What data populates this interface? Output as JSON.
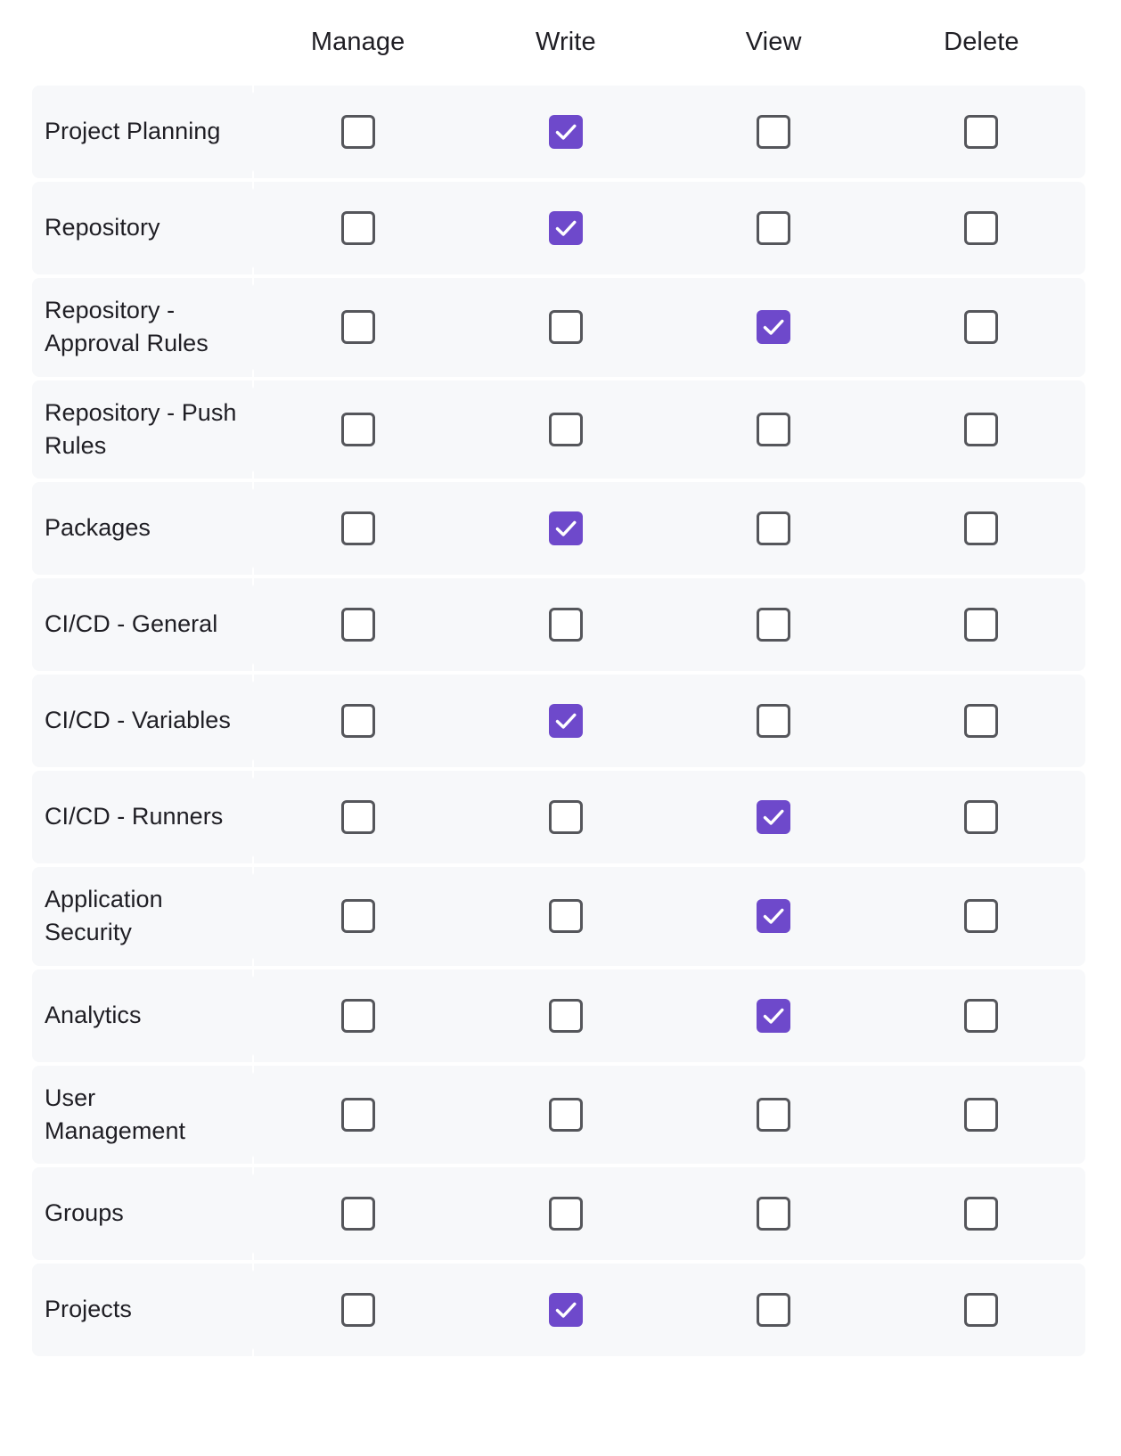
{
  "table": {
    "columns": [
      {
        "key": "manage",
        "label": "Manage"
      },
      {
        "key": "write",
        "label": "Write"
      },
      {
        "key": "view",
        "label": "View"
      },
      {
        "key": "delete",
        "label": "Delete"
      }
    ],
    "rows": [
      {
        "label": "Project Planning",
        "manage": false,
        "write": true,
        "view": false,
        "delete": false
      },
      {
        "label": "Repository",
        "manage": false,
        "write": true,
        "view": false,
        "delete": false
      },
      {
        "label": "Repository - Approval Rules",
        "manage": false,
        "write": false,
        "view": true,
        "delete": false
      },
      {
        "label": "Repository - Push Rules",
        "manage": false,
        "write": false,
        "view": false,
        "delete": false
      },
      {
        "label": "Packages",
        "manage": false,
        "write": true,
        "view": false,
        "delete": false
      },
      {
        "label": "CI/CD - General",
        "manage": false,
        "write": false,
        "view": false,
        "delete": false
      },
      {
        "label": "CI/CD - Variables",
        "manage": false,
        "write": true,
        "view": false,
        "delete": false
      },
      {
        "label": "CI/CD - Runners",
        "manage": false,
        "write": false,
        "view": true,
        "delete": false
      },
      {
        "label": "Application Security",
        "manage": false,
        "write": false,
        "view": true,
        "delete": false
      },
      {
        "label": "Analytics",
        "manage": false,
        "write": false,
        "view": true,
        "delete": false
      },
      {
        "label": "User Management",
        "manage": false,
        "write": false,
        "view": false,
        "delete": false
      },
      {
        "label": "Groups",
        "manage": false,
        "write": false,
        "view": false,
        "delete": false
      },
      {
        "label": "Projects",
        "manage": false,
        "write": true,
        "view": false,
        "delete": false
      }
    ]
  },
  "colors": {
    "checked_fill": "#6e49cb",
    "checkmark": "#ffffff",
    "unchecked_border": "#55565b",
    "row_background": "#f7f8fa",
    "page_background": "#ffffff",
    "text": "#1f1e24"
  },
  "icons": {
    "checkmark": "checkmark-icon"
  }
}
